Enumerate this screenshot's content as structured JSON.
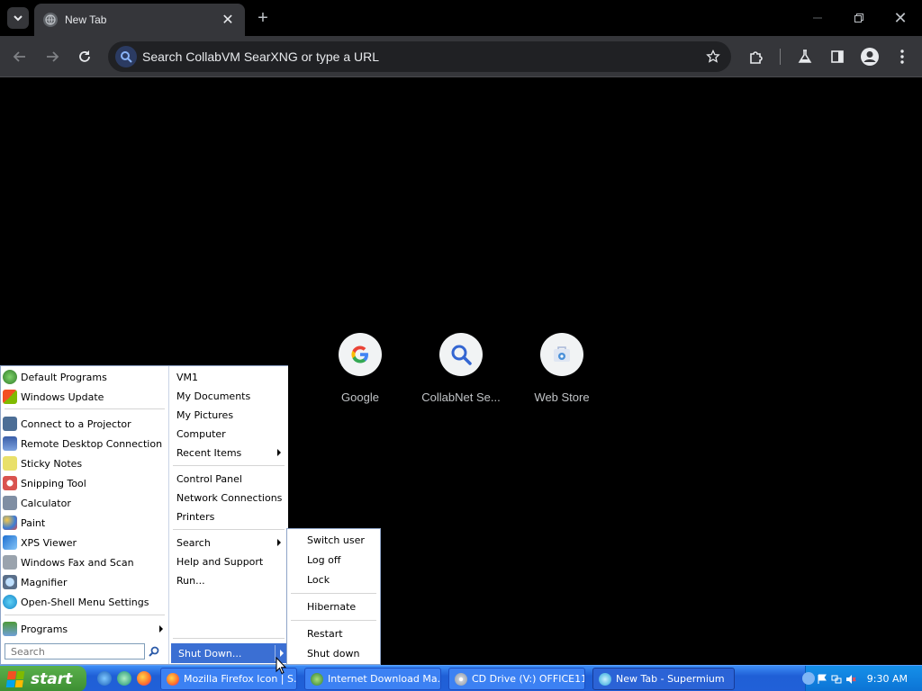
{
  "browser": {
    "tab_title": "New Tab",
    "omnibox_placeholder": "Search CollabVM SearXNG or type a URL"
  },
  "new_tab_page": {
    "shortcuts": [
      {
        "label": "Google",
        "icon": "google-icon"
      },
      {
        "label": "CollabNet Se...",
        "icon": "search-icon"
      },
      {
        "label": "Web Store",
        "icon": "web-store-icon"
      }
    ]
  },
  "start_menu": {
    "left_items": [
      {
        "label": "Default Programs",
        "icon": "default-programs-icon"
      },
      {
        "label": "Windows Update",
        "icon": "windows-update-icon"
      },
      {
        "label": "Connect to a Projector",
        "icon": "projector-icon"
      },
      {
        "label": "Remote Desktop Connection",
        "icon": "remote-desktop-icon"
      },
      {
        "label": "Sticky Notes",
        "icon": "sticky-notes-icon"
      },
      {
        "label": "Snipping Tool",
        "icon": "snipping-tool-icon"
      },
      {
        "label": "Calculator",
        "icon": "calculator-icon"
      },
      {
        "label": "Paint",
        "icon": "paint-icon"
      },
      {
        "label": "XPS Viewer",
        "icon": "xps-viewer-icon"
      },
      {
        "label": "Windows Fax and Scan",
        "icon": "fax-scan-icon"
      },
      {
        "label": "Magnifier",
        "icon": "magnifier-icon"
      },
      {
        "label": "Open-Shell Menu Settings",
        "icon": "open-shell-icon"
      }
    ],
    "programs_label": "Programs",
    "search_placeholder": "Search",
    "right_items": [
      "VM1",
      "My Documents",
      "My Pictures",
      "Computer",
      "Recent Items",
      "Control Panel",
      "Network Connections",
      "Printers",
      "Search",
      "Help and Support",
      "Run..."
    ],
    "shutdown_label": "Shut Down...",
    "shutdown_submenu": [
      "Switch user",
      "Log off",
      "Lock",
      "Hibernate",
      "Restart",
      "Shut down"
    ]
  },
  "taskbar": {
    "start_label": "start",
    "tasks": [
      "Mozilla Firefox Icon | S...",
      "Internet Download Ma...",
      "CD Drive (V:) OFFICE11",
      "New Tab - Supermium"
    ],
    "clock": "9:30 AM"
  },
  "colors": {
    "taskbar_blue": "#2160d8",
    "start_green": "#3c8e32",
    "chrome_toolbar": "#35363a",
    "selection_blue": "#3b6fd3"
  }
}
